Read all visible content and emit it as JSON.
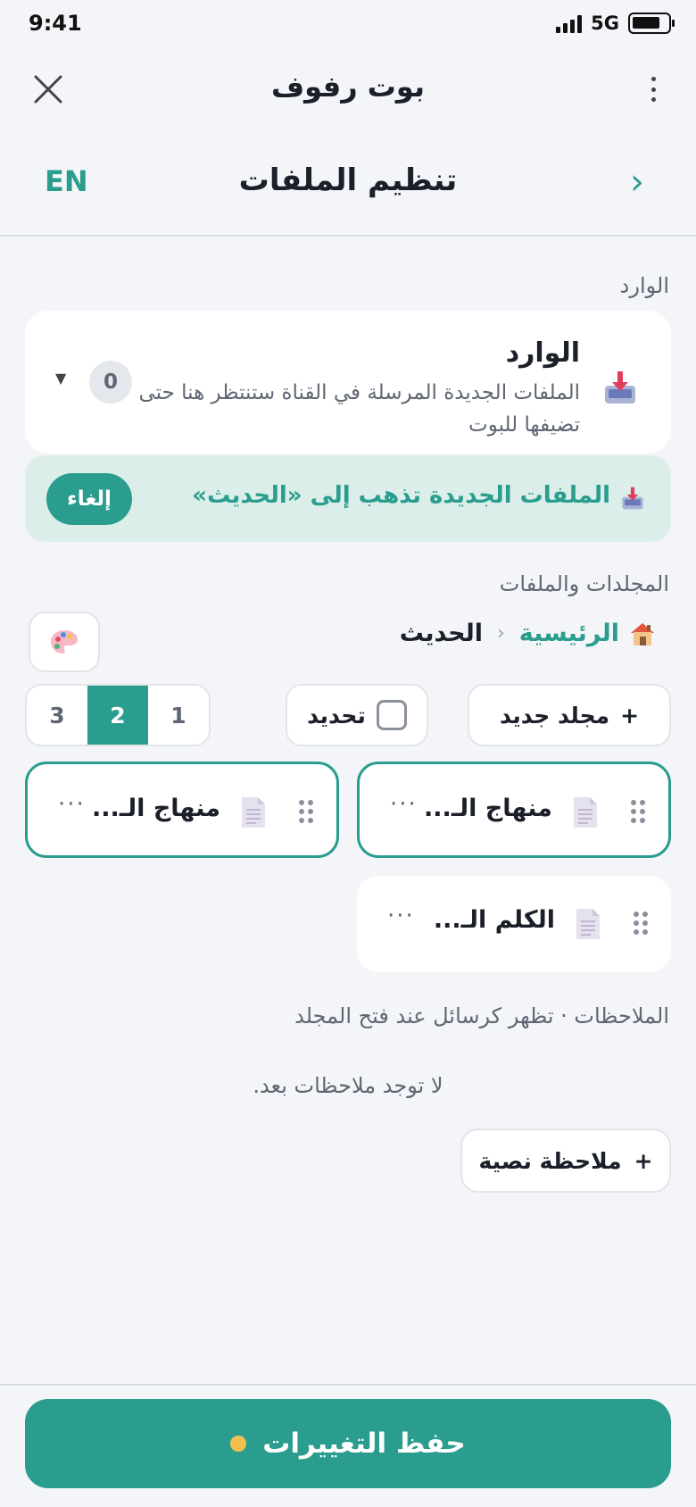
{
  "status_bar": {
    "time": "9:41",
    "network": "5G"
  },
  "top_bar": {
    "title": "بوت رفوف"
  },
  "header": {
    "title": "تنظيم الملفات",
    "lang": "EN",
    "back": "›"
  },
  "inbox_section": {
    "label": "الوارد",
    "card_title": "الوارد",
    "card_desc": "الملفات الجديدة المرسلة في القناة ستنتظر هنا حتى تضيفها للبوت",
    "count": "0"
  },
  "banner": {
    "text": "الملفات الجديدة تذهب إلى «الحديث»",
    "cancel": "إلغاء"
  },
  "folders_section": {
    "label": "المجلدات والملفات"
  },
  "breadcrumb": {
    "home": "الرئيسية",
    "separator": "‹",
    "current": "الحديث"
  },
  "toolbar": {
    "new_folder": "مجلد جديد",
    "new_folder_icon": "+",
    "select": "تحديد",
    "pages": [
      "1",
      "2",
      "3"
    ],
    "active_page": "2"
  },
  "files": [
    {
      "name": "منهاج الـ...",
      "selected": true
    },
    {
      "name": "منهاج الـ...",
      "selected": true
    },
    {
      "name": "الكلم الـ...",
      "selected": false
    }
  ],
  "file_menu_glyph": "···",
  "notes": {
    "label": "الملاحظات · تظهر كرسائل عند فتح المجلد",
    "empty": "لا توجد ملاحظات بعد.",
    "add_button": "ملاحظة نصية",
    "add_icon": "+"
  },
  "footer": {
    "save": "حفظ التغييرات"
  },
  "colors": {
    "accent": "#2a9d8f",
    "banner_bg": "#dceeea",
    "unsaved_dot": "#f4c04d"
  }
}
